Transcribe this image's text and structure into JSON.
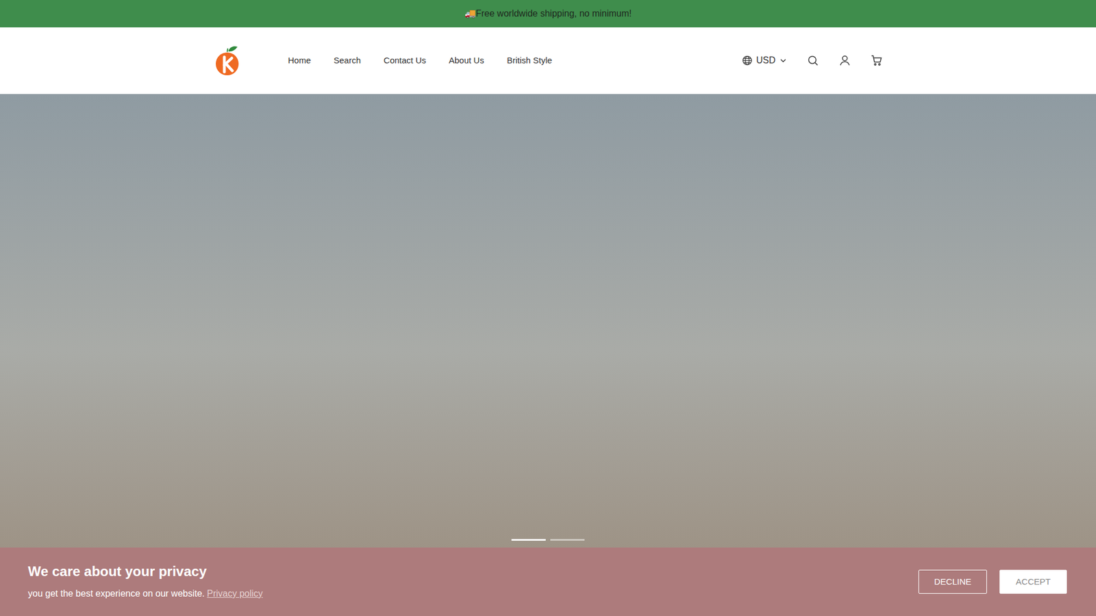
{
  "announcement": {
    "text": "🚚Free worldwide shipping, no minimum!"
  },
  "header": {
    "nav": [
      "Home",
      "Search",
      "Contact Us",
      "About Us",
      "British Style"
    ],
    "currency": "USD"
  },
  "hero": {
    "slides": [
      {
        "selected": true
      },
      {
        "selected": false
      }
    ]
  },
  "cookie_banner": {
    "title": "We care about your privacy",
    "text": "you get the best experience on our website.",
    "link": "Privacy policy",
    "buttons": [
      "DECLINE",
      "ACCEPT"
    ]
  }
}
